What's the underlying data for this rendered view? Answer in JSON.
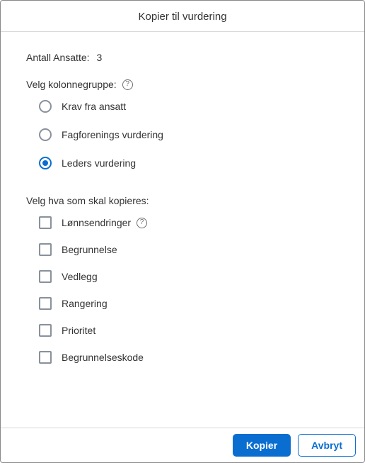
{
  "dialog": {
    "title": "Kopier til vurdering"
  },
  "employees": {
    "label": "Antall Ansatte:",
    "value": "3"
  },
  "columnGroup": {
    "label": "Velg kolonnegruppe:",
    "options": [
      {
        "label": "Krav fra ansatt",
        "selected": false
      },
      {
        "label": "Fagforenings vurdering",
        "selected": false
      },
      {
        "label": "Leders vurdering",
        "selected": true
      }
    ]
  },
  "copyItems": {
    "label": "Velg hva som skal kopieres:",
    "options": [
      {
        "label": "Lønnsendringer",
        "checked": false,
        "hasHelp": true
      },
      {
        "label": "Begrunnelse",
        "checked": false,
        "hasHelp": false
      },
      {
        "label": "Vedlegg",
        "checked": false,
        "hasHelp": false
      },
      {
        "label": "Rangering",
        "checked": false,
        "hasHelp": false
      },
      {
        "label": "Prioritet",
        "checked": false,
        "hasHelp": false
      },
      {
        "label": "Begrunnelseskode",
        "checked": false,
        "hasHelp": false
      }
    ]
  },
  "buttons": {
    "primary": "Kopier",
    "secondary": "Avbryt"
  }
}
